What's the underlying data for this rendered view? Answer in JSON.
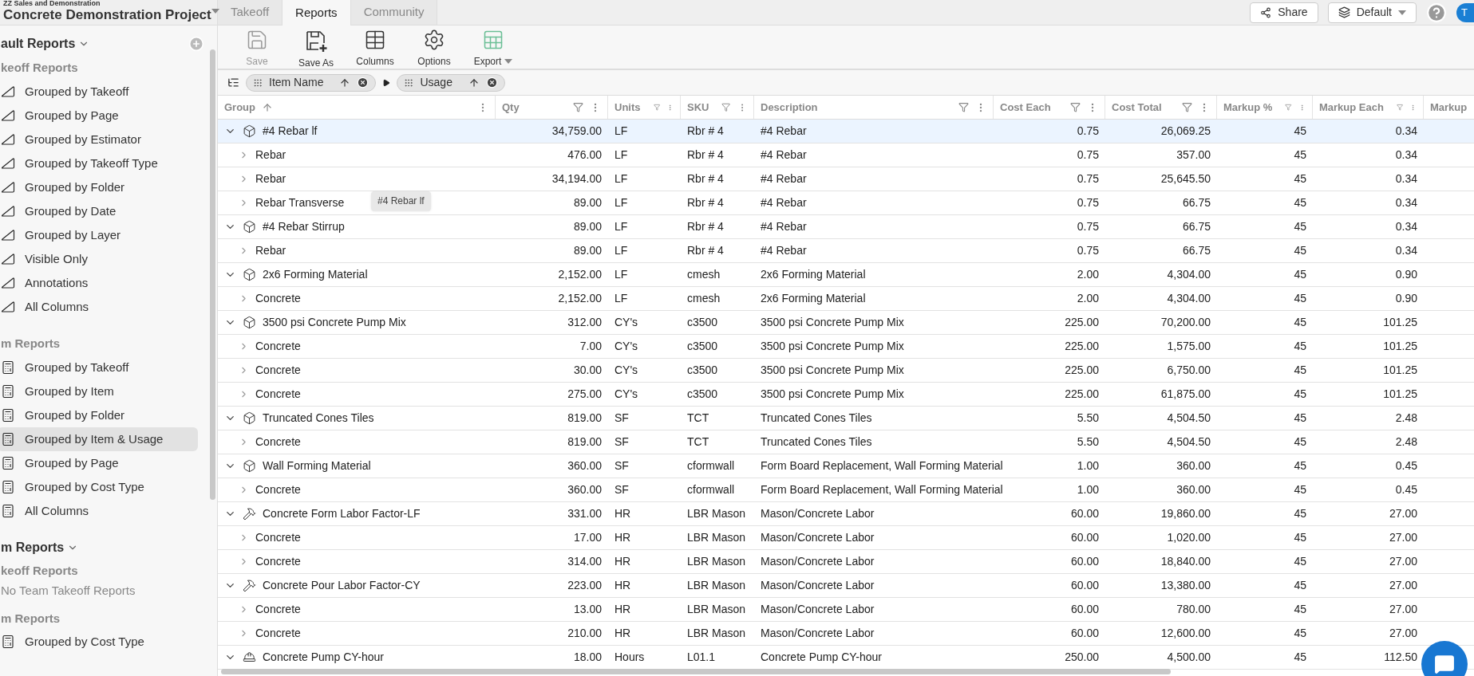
{
  "project": {
    "org": "ZZ Sales and Demonstration",
    "title": "Concrete Demonstration Project"
  },
  "tabs": [
    {
      "label": "Takeoff",
      "selected": false
    },
    {
      "label": "Reports",
      "selected": true
    },
    {
      "label": "Community",
      "selected": false
    }
  ],
  "header_buttons": [
    {
      "kind": "share",
      "label": "Share"
    },
    {
      "kind": "view",
      "label": "Default"
    }
  ],
  "avatar": {
    "initial": "T"
  },
  "toolbar": [
    {
      "kind": "save",
      "label": "Save",
      "disabled": true
    },
    {
      "kind": "save_as",
      "label": "Save As",
      "disabled": false
    },
    {
      "kind": "columns",
      "label": "Columns",
      "disabled": false
    },
    {
      "kind": "options",
      "label": "Options",
      "disabled": false
    },
    {
      "kind": "export",
      "label": "Export",
      "disabled": false
    }
  ],
  "grouping": [
    {
      "label": "Item Name"
    },
    {
      "label": "Usage"
    }
  ],
  "sidebar": {
    "title": "ault Reports",
    "sections": [
      {
        "title": "keoff Reports",
        "items": [
          {
            "label": "Grouped by Takeoff",
            "kind": "takeoff",
            "selected": false
          },
          {
            "label": "Grouped by Page",
            "kind": "takeoff",
            "selected": false
          },
          {
            "label": "Grouped by Estimator",
            "kind": "takeoff",
            "selected": false
          },
          {
            "label": "Grouped by Takeoff Type",
            "kind": "takeoff",
            "selected": false
          },
          {
            "label": "Grouped by Folder",
            "kind": "takeoff",
            "selected": false
          },
          {
            "label": "Grouped by Date",
            "kind": "takeoff",
            "selected": false
          },
          {
            "label": "Grouped by Layer",
            "kind": "takeoff",
            "selected": false
          },
          {
            "label": "Visible Only",
            "kind": "takeoff",
            "selected": false
          },
          {
            "label": "Annotations",
            "kind": "takeoff",
            "selected": false
          },
          {
            "label": "All Columns",
            "kind": "takeoff",
            "selected": false
          }
        ]
      },
      {
        "title": "m Reports",
        "items": [
          {
            "label": "Grouped by Takeoff",
            "kind": "item",
            "selected": false
          },
          {
            "label": "Grouped by Item",
            "kind": "item",
            "selected": false
          },
          {
            "label": "Grouped by Folder",
            "kind": "item",
            "selected": false
          },
          {
            "label": "Grouped by Item & Usage",
            "kind": "item",
            "selected": true
          },
          {
            "label": "Grouped by Page",
            "kind": "item",
            "selected": false
          },
          {
            "label": "Grouped by Cost Type",
            "kind": "item",
            "selected": false
          },
          {
            "label": "All Columns",
            "kind": "item",
            "selected": false
          }
        ]
      }
    ],
    "team_title": "m Reports",
    "team_sections": [
      {
        "title": "keoff Reports",
        "empty": "No Team Takeoff Reports"
      },
      {
        "title": "m Reports",
        "items": [
          {
            "label": "Grouped by Cost Type",
            "kind": "item",
            "selected": false
          }
        ]
      }
    ]
  },
  "columns": [
    {
      "label": "Group",
      "sorted": true,
      "filter": false
    },
    {
      "label": "Qty",
      "sorted": false,
      "filter": true
    },
    {
      "label": "Units",
      "sorted": false,
      "filter": true
    },
    {
      "label": "SKU",
      "sorted": false,
      "filter": true
    },
    {
      "label": "Description",
      "sorted": false,
      "filter": true
    },
    {
      "label": "Cost Each",
      "sorted": false,
      "filter": true
    },
    {
      "label": "Cost Total",
      "sorted": false,
      "filter": true
    },
    {
      "label": "Markup %",
      "sorted": false,
      "filter": true
    },
    {
      "label": "Markup Each",
      "sorted": false,
      "filter": true
    },
    {
      "label": "Markup"
    }
  ],
  "rows": [
    {
      "kind": "material",
      "expanded": true,
      "selected": true,
      "cells": [
        "#4 Rebar lf",
        "34,759.00",
        "LF",
        "Rbr # 4",
        "#4 Rebar",
        "0.75",
        "26,069.25",
        "45",
        "0.34"
      ]
    },
    {
      "kind": "usage",
      "expanded": false,
      "selected": false,
      "cells": [
        "Rebar",
        "476.00",
        "LF",
        "Rbr # 4",
        "#4 Rebar",
        "0.75",
        "357.00",
        "45",
        "0.34"
      ]
    },
    {
      "kind": "usage",
      "expanded": false,
      "selected": false,
      "cells": [
        "Rebar",
        "34,194.00",
        "LF",
        "Rbr # 4",
        "#4 Rebar",
        "0.75",
        "25,645.50",
        "45",
        "0.34"
      ]
    },
    {
      "kind": "usage",
      "expanded": false,
      "selected": false,
      "cells": [
        "Rebar Transverse",
        "89.00",
        "LF",
        "Rbr # 4",
        "#4 Rebar",
        "0.75",
        "66.75",
        "45",
        "0.34"
      ]
    },
    {
      "kind": "material",
      "expanded": true,
      "selected": false,
      "cells": [
        "#4 Rebar Stirrup",
        "89.00",
        "LF",
        "Rbr # 4",
        "#4 Rebar",
        "0.75",
        "66.75",
        "45",
        "0.34"
      ]
    },
    {
      "kind": "usage",
      "expanded": false,
      "selected": false,
      "cells": [
        "Rebar",
        "89.00",
        "LF",
        "Rbr # 4",
        "#4 Rebar",
        "0.75",
        "66.75",
        "45",
        "0.34"
      ]
    },
    {
      "kind": "material",
      "expanded": true,
      "selected": false,
      "cells": [
        "2x6 Forming Material",
        "2,152.00",
        "LF",
        "cmesh",
        "2x6 Forming Material",
        "2.00",
        "4,304.00",
        "45",
        "0.90"
      ]
    },
    {
      "kind": "usage",
      "expanded": false,
      "selected": false,
      "cells": [
        "Concrete",
        "2,152.00",
        "LF",
        "cmesh",
        "2x6 Forming Material",
        "2.00",
        "4,304.00",
        "45",
        "0.90"
      ]
    },
    {
      "kind": "material",
      "expanded": true,
      "selected": false,
      "cells": [
        "3500 psi Concrete Pump Mix",
        "312.00",
        "CY's",
        "c3500",
        "3500 psi Concrete Pump Mix",
        "225.00",
        "70,200.00",
        "45",
        "101.25"
      ]
    },
    {
      "kind": "usage",
      "expanded": false,
      "selected": false,
      "cells": [
        "Concrete",
        "7.00",
        "CY's",
        "c3500",
        "3500 psi Concrete Pump Mix",
        "225.00",
        "1,575.00",
        "45",
        "101.25"
      ]
    },
    {
      "kind": "usage",
      "expanded": false,
      "selected": false,
      "cells": [
        "Concrete",
        "30.00",
        "CY's",
        "c3500",
        "3500 psi Concrete Pump Mix",
        "225.00",
        "6,750.00",
        "45",
        "101.25"
      ]
    },
    {
      "kind": "usage",
      "expanded": false,
      "selected": false,
      "cells": [
        "Concrete",
        "275.00",
        "CY's",
        "c3500",
        "3500 psi Concrete Pump Mix",
        "225.00",
        "61,875.00",
        "45",
        "101.25"
      ]
    },
    {
      "kind": "material",
      "expanded": true,
      "selected": false,
      "cells": [
        "Truncated Cones Tiles",
        "819.00",
        "SF",
        "TCT",
        "Truncated Cones Tiles",
        "5.50",
        "4,504.50",
        "45",
        "2.48"
      ]
    },
    {
      "kind": "usage",
      "expanded": false,
      "selected": false,
      "cells": [
        "Concrete",
        "819.00",
        "SF",
        "TCT",
        "Truncated Cones Tiles",
        "5.50",
        "4,504.50",
        "45",
        "2.48"
      ]
    },
    {
      "kind": "material",
      "expanded": true,
      "selected": false,
      "cells": [
        "Wall Forming Material",
        "360.00",
        "SF",
        "cformwall",
        "Form Board Replacement, Wall Forming Material",
        "1.00",
        "360.00",
        "45",
        "0.45"
      ]
    },
    {
      "kind": "usage",
      "expanded": false,
      "selected": false,
      "cells": [
        "Concrete",
        "360.00",
        "SF",
        "cformwall",
        "Form Board Replacement, Wall Forming Material",
        "1.00",
        "360.00",
        "45",
        "0.45"
      ]
    },
    {
      "kind": "labor",
      "expanded": true,
      "selected": false,
      "cells": [
        "Concrete Form Labor Factor-LF",
        "331.00",
        "HR",
        "LBR Mason",
        "Mason/Concrete Labor",
        "60.00",
        "19,860.00",
        "45",
        "27.00"
      ]
    },
    {
      "kind": "usage",
      "expanded": false,
      "selected": false,
      "cells": [
        "Concrete",
        "17.00",
        "HR",
        "LBR Mason",
        "Mason/Concrete Labor",
        "60.00",
        "1,020.00",
        "45",
        "27.00"
      ]
    },
    {
      "kind": "usage",
      "expanded": false,
      "selected": false,
      "cells": [
        "Concrete",
        "314.00",
        "HR",
        "LBR Mason",
        "Mason/Concrete Labor",
        "60.00",
        "18,840.00",
        "45",
        "27.00"
      ]
    },
    {
      "kind": "labor",
      "expanded": true,
      "selected": false,
      "cells": [
        "Concrete Pour Labor Factor-CY",
        "223.00",
        "HR",
        "LBR Mason",
        "Mason/Concrete Labor",
        "60.00",
        "13,380.00",
        "45",
        "27.00"
      ]
    },
    {
      "kind": "usage",
      "expanded": false,
      "selected": false,
      "cells": [
        "Concrete",
        "13.00",
        "HR",
        "LBR Mason",
        "Mason/Concrete Labor",
        "60.00",
        "780.00",
        "45",
        "27.00"
      ]
    },
    {
      "kind": "usage",
      "expanded": false,
      "selected": false,
      "cells": [
        "Concrete",
        "210.00",
        "HR",
        "LBR Mason",
        "Mason/Concrete Labor",
        "60.00",
        "12,600.00",
        "45",
        "27.00"
      ]
    },
    {
      "kind": "equipment",
      "expanded": true,
      "selected": false,
      "cells": [
        "Concrete Pump CY-hour",
        "18.00",
        "Hours",
        "L01.1",
        "Concrete Pump CY-hour",
        "250.00",
        "4,500.00",
        "45",
        "112.50"
      ]
    }
  ],
  "tooltip": {
    "text": "#4 Rebar lf"
  }
}
